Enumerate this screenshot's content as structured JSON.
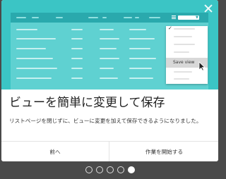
{
  "dialog": {
    "title": "ビューを簡単に変更して保存",
    "description": "リストページを閉じずに、ビューに変更を加えて保存できるようになりました。",
    "buttons": {
      "prev": "前へ",
      "start": "作業を開始する"
    },
    "close_icon": "close-icon"
  },
  "illustration": {
    "dropdown": {
      "checkmark": "✓",
      "save_view": "Save view"
    },
    "colors": {
      "hero": "#3bc5c5",
      "mock": "#5fd1d1",
      "toolbar": "#2aa9ad"
    }
  },
  "pagination": {
    "total": 5,
    "active": 5
  }
}
